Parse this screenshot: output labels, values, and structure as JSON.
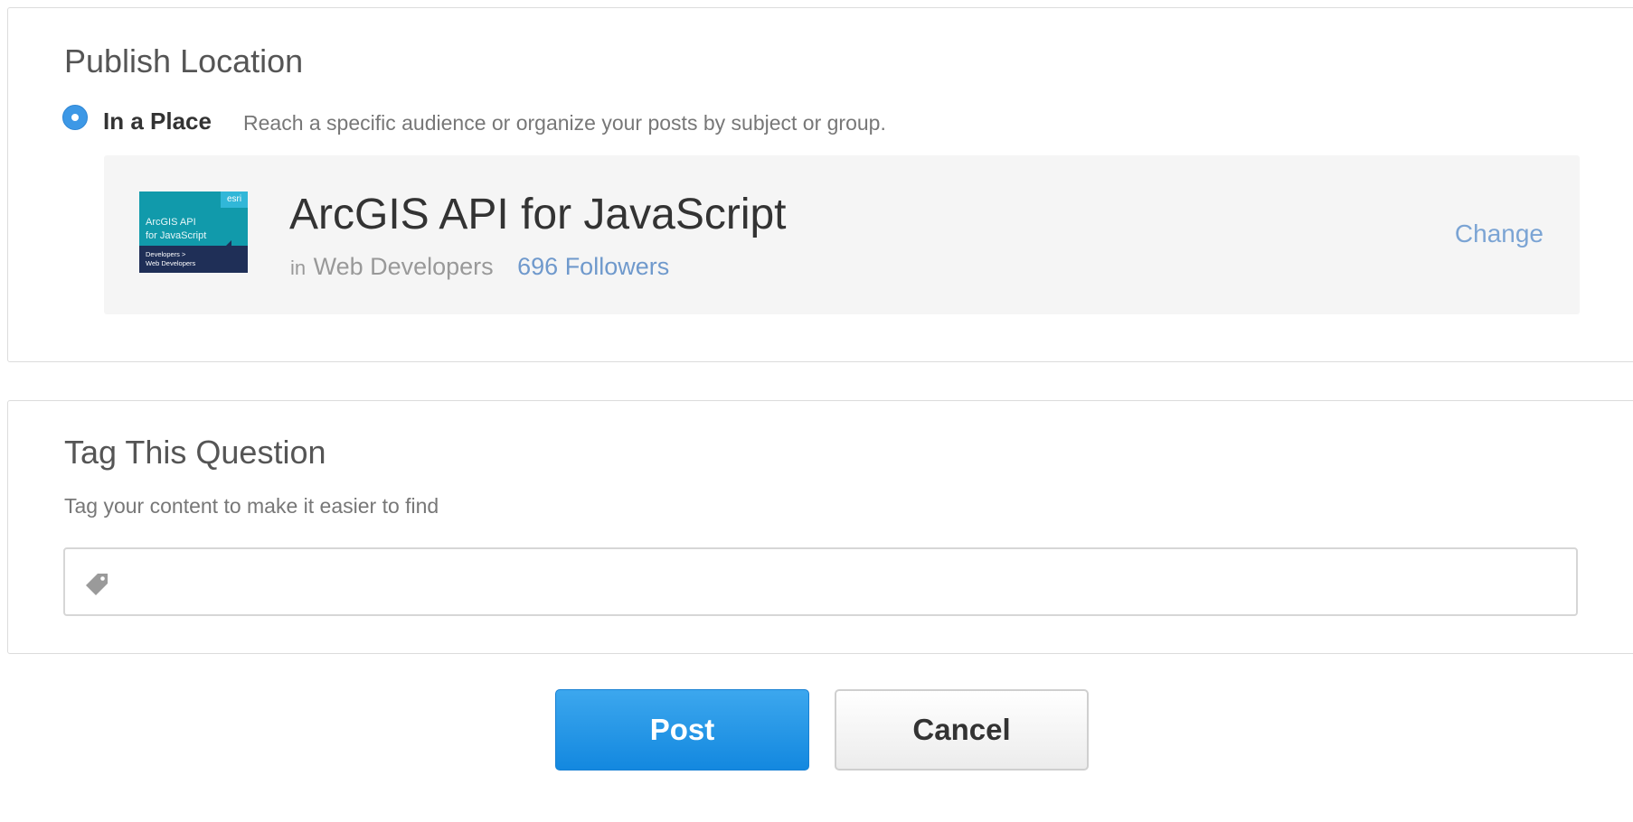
{
  "publish": {
    "title": "Publish Location",
    "option_label": "In a Place",
    "option_desc": "Reach a specific audience or organize your posts by subject or group.",
    "place": {
      "thumb_brand": "esri",
      "thumb_line1": "ArcGIS API",
      "thumb_line2": "for JavaScript",
      "thumb_sub1": "Developers >",
      "thumb_sub2": "Web Developers",
      "name": "ArcGIS API for JavaScript",
      "in_word": "in",
      "community": "Web Developers",
      "followers": "696 Followers",
      "change": "Change"
    }
  },
  "tags": {
    "title": "Tag This Question",
    "description": "Tag your content to make it easier to find",
    "input_value": "",
    "icon": "tag-icon"
  },
  "actions": {
    "post": "Post",
    "cancel": "Cancel"
  },
  "colors": {
    "accent": "#3d98e6",
    "link": "#6f99cc",
    "post_button": "#1a8be0",
    "thumb_bg": "#119aab",
    "thumb_footer": "#1f2f57"
  }
}
